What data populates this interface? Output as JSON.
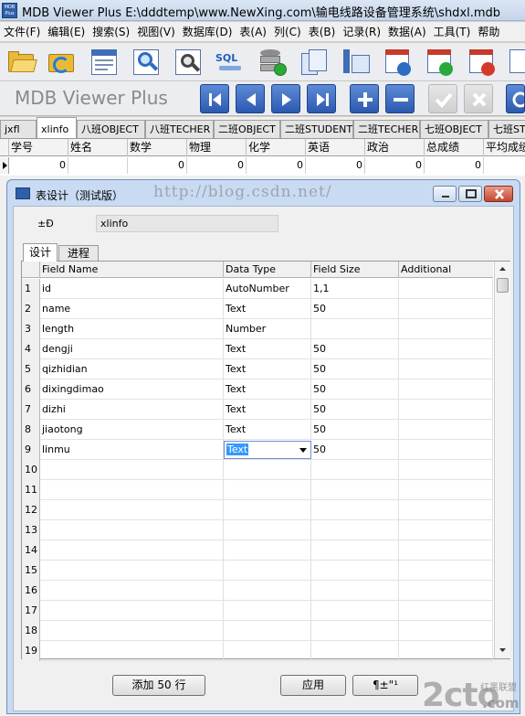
{
  "app": {
    "title": "MDB Viewer Plus E:\\dddtemp\\www.NewXing.com\\输电线路设备管理系统\\shdxl.mdb",
    "icon_label": "MDB Plus"
  },
  "menu": [
    "文件(F)",
    "编辑(E)",
    "搜索(S)",
    "视图(V)",
    "数据库(D)",
    "表(A)",
    "列(C)",
    "表(B)",
    "记录(R)",
    "数据(A)",
    "工具(T)",
    "帮助"
  ],
  "toolbar": {
    "brand": "MDB Viewer Plus",
    "sql_label": "SQL",
    "icons": [
      "open-folder-icon",
      "refresh-folder-icon",
      "document-icon",
      "search-icon",
      "zoom-document-icon",
      "sql-icon",
      "database-add-icon",
      "tables-icon",
      "columns-icon",
      "table-info-icon",
      "table-add-icon",
      "table-delete-icon",
      "table-more-icon"
    ],
    "nav": [
      "first-record-icon",
      "previous-record-icon",
      "next-record-icon",
      "last-record-icon",
      "add-record-icon",
      "delete-record-icon",
      "confirm-icon",
      "cancel-icon",
      "refresh-icon"
    ]
  },
  "tables": [
    "jxfl",
    "xlinfo",
    "八班OBJECT",
    "八班TECHER",
    "二班OBJECT",
    "二班STUDENT",
    "二班TECHER",
    "七班OBJECT",
    "七班ST"
  ],
  "active_table": "xlinfo",
  "main_grid": {
    "columns": [
      "学号",
      "姓名",
      "数学",
      "物理",
      "化学",
      "英语",
      "政治",
      "总成绩",
      "平均成绩"
    ],
    "row": [
      "0",
      "",
      "0",
      "0",
      "0",
      "0",
      "0",
      "0",
      ""
    ]
  },
  "dialog": {
    "title": "表设计（测试版）",
    "table_name_label": "±Ð",
    "table_name_value": "xlinfo",
    "tabs": [
      "设计",
      "进程"
    ],
    "headers": [
      "Field Name",
      "Data Type",
      "Field Size",
      "Additional"
    ],
    "rows": [
      {
        "num": "1",
        "name": "id",
        "type": "AutoNumber",
        "size": "1,1"
      },
      {
        "num": "2",
        "name": "name",
        "type": "Text",
        "size": "50"
      },
      {
        "num": "3",
        "name": "length",
        "type": "Number",
        "size": ""
      },
      {
        "num": "4",
        "name": "dengji",
        "type": "Text",
        "size": "50"
      },
      {
        "num": "5",
        "name": "qizhidian",
        "type": "Text",
        "size": "50"
      },
      {
        "num": "6",
        "name": "dixingdimao",
        "type": "Text",
        "size": "50"
      },
      {
        "num": "7",
        "name": "dizhi",
        "type": "Text",
        "size": "50"
      },
      {
        "num": "8",
        "name": "jiaotong",
        "type": "Text",
        "size": "50"
      },
      {
        "num": "9",
        "name": "linmu",
        "type": "Text",
        "size": "50"
      },
      {
        "num": "10",
        "name": "",
        "type": "",
        "size": ""
      },
      {
        "num": "11",
        "name": "",
        "type": "",
        "size": ""
      },
      {
        "num": "12",
        "name": "",
        "type": "",
        "size": ""
      },
      {
        "num": "13",
        "name": "",
        "type": "",
        "size": ""
      },
      {
        "num": "14",
        "name": "",
        "type": "",
        "size": ""
      },
      {
        "num": "15",
        "name": "",
        "type": "",
        "size": ""
      },
      {
        "num": "16",
        "name": "",
        "type": "",
        "size": ""
      },
      {
        "num": "17",
        "name": "",
        "type": "",
        "size": ""
      },
      {
        "num": "18",
        "name": "",
        "type": "",
        "size": ""
      },
      {
        "num": "19",
        "name": "",
        "type": "",
        "size": ""
      }
    ],
    "buttons": {
      "add_rows": "添加 50 行",
      "apply": "应用",
      "close": "¶±\"¹"
    }
  },
  "watermark": "http://blog.csdn.net/",
  "site_logo": {
    "text": "2cto",
    "domain": ".com",
    "tag": "红黑联盟"
  }
}
